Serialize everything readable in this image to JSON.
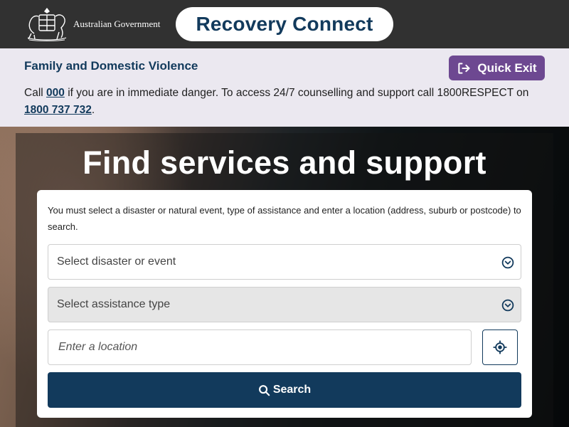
{
  "header": {
    "gov_name": "Australian Government",
    "brand": "Recovery Connect",
    "crest_icon": "coat-of-arms-icon"
  },
  "fdv_banner": {
    "title": "Family and Domestic Violence",
    "quick_exit_label": "Quick Exit",
    "quick_exit_icon": "exit-icon",
    "message_part1": "Call ",
    "emergency_number": "000",
    "message_part2": " if you are in immediate danger. To access 24/7 counselling and support call 1800RESPECT on ",
    "respect_number": "1800 737 732",
    "message_end": "."
  },
  "hero": {
    "title": "Find services and support"
  },
  "search_form": {
    "instructions": "You must select a disaster or natural event, type of assistance and enter a location (address, suburb or postcode) to search.",
    "disaster_select": "Select disaster or event",
    "assistance_select": "Select assistance type",
    "location_placeholder": "Enter a location",
    "location_value": "",
    "geolocate_icon": "crosshair-icon",
    "search_label": "Search",
    "search_icon": "search-icon"
  },
  "colors": {
    "header_bg": "#313131",
    "brand_navy": "#123a5c",
    "banner_bg": "#ebe8f0",
    "quick_exit_purple": "#6d4891",
    "select_disabled_bg": "#e6e6e6"
  }
}
